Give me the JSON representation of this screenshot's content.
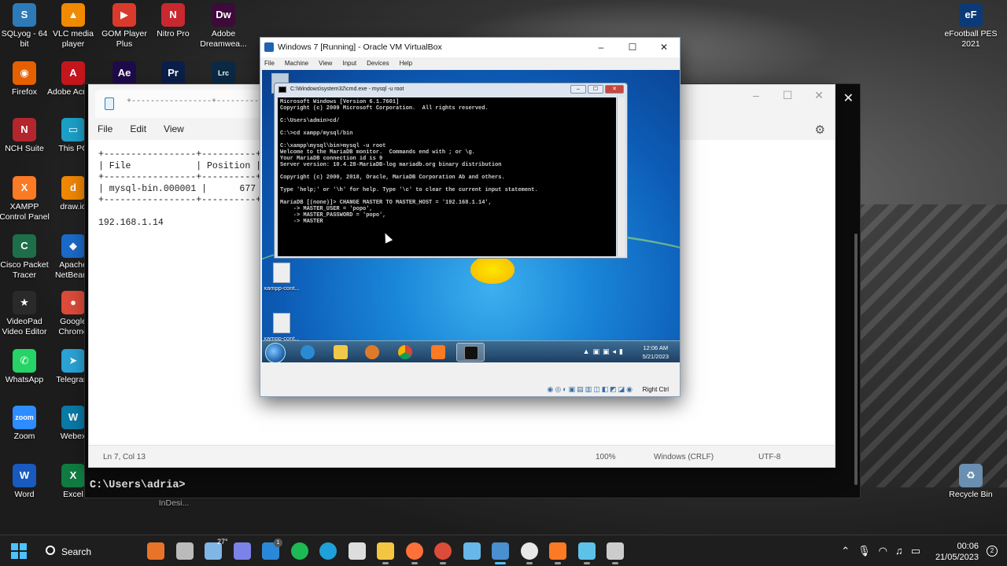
{
  "desktop": {
    "left_icons": [
      {
        "label": "SQLyog - 64 bit",
        "glyph": "S",
        "color": "#2d7ab8"
      },
      {
        "label": "VLC media player",
        "glyph": "▲",
        "color": "#f08a00"
      },
      {
        "label": "GOM Player Plus",
        "glyph": "▶",
        "color": "#d93a2b"
      },
      {
        "label": "Nitro Pro",
        "glyph": "N",
        "color": "#c8282f"
      },
      {
        "label": "Adobe Dreamwea...",
        "glyph": "Dw",
        "color": "#3d0a3a"
      },
      {
        "label": "Firefox",
        "glyph": "◉",
        "color": "#e66000"
      },
      {
        "label": "Adobe Acroba",
        "glyph": "A",
        "color": "#c5161d"
      },
      {
        "label": "",
        "glyph": "Ae",
        "color": "#1e0b4b"
      },
      {
        "label": "",
        "glyph": "Pr",
        "color": "#0b1f4b"
      },
      {
        "label": "",
        "glyph": "Lrc",
        "color": "#0c2a45"
      },
      {
        "label": "NCH Suite",
        "glyph": "N",
        "color": "#b3262d"
      },
      {
        "label": "This PC",
        "glyph": "▭",
        "color": "#1ca0c8"
      },
      {
        "label": "XAMPP Control Panel",
        "glyph": "X",
        "color": "#fb7a24"
      },
      {
        "label": "draw.io",
        "glyph": "d",
        "color": "#f08705"
      },
      {
        "label": "Cisco Packet Tracer",
        "glyph": "C",
        "color": "#1e6e4a"
      },
      {
        "label": "Apache NetBeans",
        "glyph": "◆",
        "color": "#1b6ac9"
      },
      {
        "label": "VideoPad Video Editor",
        "glyph": "★",
        "color": "#2a2a2a"
      },
      {
        "label": "Google Chrome",
        "glyph": "●",
        "color": "#dd4b39"
      },
      {
        "label": "WhatsApp",
        "glyph": "✆",
        "color": "#25d366"
      },
      {
        "label": "Telegram",
        "glyph": "➤",
        "color": "#2aa3d6"
      },
      {
        "label": "Zoom",
        "glyph": "zoom",
        "color": "#2d8cff"
      },
      {
        "label": "Webex",
        "glyph": "W",
        "color": "#0a7aa7"
      },
      {
        "label": "Word",
        "glyph": "W",
        "color": "#185abd"
      },
      {
        "label": "Excel",
        "glyph": "X",
        "color": "#107c41"
      }
    ],
    "right_icons": [
      {
        "label": "eFootball PES 2021",
        "glyph": "eF",
        "color": "#0c3a78"
      },
      {
        "label": "Recycle Bin",
        "glyph": "♻",
        "color": "#6a8fb0"
      }
    ],
    "indesign_label": "InDesi..."
  },
  "notepad": {
    "tab_title": "+-----------------+----------+---",
    "menu": [
      "File",
      "Edit",
      "View"
    ],
    "content": "+-----------------+----------+--\n| File            | Position |\n+-----------------+----------+--\n| mysql-bin.000001 |      677 |\n+-----------------+----------+--\n\n192.168.1.14",
    "status": {
      "position": "Ln 7, Col 13",
      "zoom": "100%",
      "line_ending": "Windows (CRLF)",
      "encoding": "UTF-8"
    }
  },
  "terminal": {
    "prompt": "C:\\Users\\adria>"
  },
  "virtualbox": {
    "title": "Windows 7 [Running] - Oracle VM VirtualBox",
    "menu": [
      "File",
      "Machine",
      "View",
      "Input",
      "Devices",
      "Help"
    ],
    "status_right": "Right Ctrl",
    "vm": {
      "desktop_icons": [
        {
          "label": "Re"
        },
        {
          "label": "xampp-cont..."
        },
        {
          "label": "xampp-cont..."
        }
      ],
      "clock_time": "12:06 AM",
      "clock_date": "5/21/2023",
      "cmd": {
        "title": "C:\\Windows\\system32\\cmd.exe - mysql -u root",
        "output": "Microsoft Windows [Version 6.1.7601]\nCopyright (c) 2009 Microsoft Corporation.  All rights reserved.\n\nC:\\Users\\admin>cd/\n\nC:\\>cd xampp/mysql/bin\n\nC:\\xampp\\mysql\\bin>mysql -u root\nWelcome to the MariaDB monitor.  Commands end with ; or \\g.\nYour MariaDB connection id is 9\nServer version: 10.4.28-MariaDB-log mariadb.org binary distribution\n\nCopyright (c) 2000, 2018, Oracle, MariaDB Corporation Ab and others.\n\nType 'help;' or '\\h' for help. Type '\\c' to clear the current input statement.\n\nMariaDB [(none)]> CHANGE MASTER TO MASTER_HOST = '192.168.1.14',\n    -> MASTER_USER = 'popo',\n    -> MASTER_PASSWORD = 'popo',\n    -> MASTER"
      }
    }
  },
  "taskbar": {
    "search_label": "Search",
    "weather": "27°",
    "clock_time": "00:06",
    "clock_date": "21/05/2023",
    "notif_count": "2",
    "apps": [
      {
        "name": "widgets",
        "color": "#e8742a"
      },
      {
        "name": "task-view",
        "color": "#bbbbbb"
      },
      {
        "name": "weather",
        "color": "#7fb6e6"
      },
      {
        "name": "teams-chat",
        "color": "#7b83eb"
      },
      {
        "name": "store",
        "color": "#2b88d8"
      },
      {
        "name": "spotify",
        "color": "#1db954"
      },
      {
        "name": "edge",
        "color": "#1fa0d8"
      },
      {
        "name": "unity",
        "color": "#dddddd"
      },
      {
        "name": "file-explorer",
        "color": "#f4c542"
      },
      {
        "name": "firefox",
        "color": "#ff7139"
      },
      {
        "name": "chrome",
        "color": "#dd4b39"
      },
      {
        "name": "3d-viewer",
        "color": "#68b7e8"
      },
      {
        "name": "virtualbox",
        "color": "#4a8fd0"
      },
      {
        "name": "git",
        "color": "#e8e8e8"
      },
      {
        "name": "xampp",
        "color": "#fb7a24"
      },
      {
        "name": "notepad",
        "color": "#5ec2e8"
      },
      {
        "name": "terminal",
        "color": "#cccccc"
      }
    ]
  }
}
